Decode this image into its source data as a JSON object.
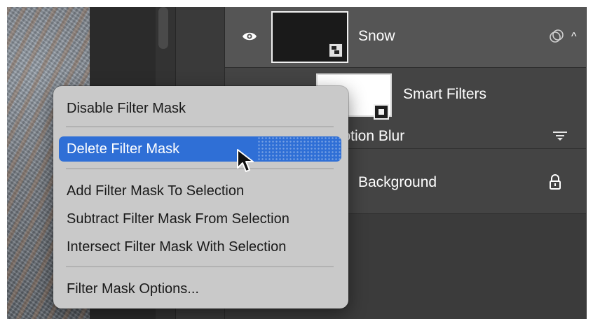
{
  "layers": [
    {
      "name": "Snow",
      "type": "smart-object",
      "visible": true,
      "selected": true
    },
    {
      "name": "Smart Filters",
      "type": "smart-filters"
    },
    {
      "name": "Motion Blur",
      "type": "filter"
    },
    {
      "name": "Background",
      "type": "background",
      "locked": true
    }
  ],
  "context_menu": {
    "items": [
      {
        "label": "Disable Filter Mask"
      },
      {
        "label": "Delete Filter Mask",
        "highlighted": true
      },
      {
        "label": "Add Filter Mask To Selection"
      },
      {
        "label": "Subtract Filter Mask From Selection"
      },
      {
        "label": "Intersect Filter Mask With Selection"
      },
      {
        "label": "Filter Mask Options..."
      }
    ]
  },
  "icons": {
    "visibility": "eye-icon",
    "smart_object": "smart-object-badge-icon",
    "fx": "fx-icon",
    "collapse": "chevron-up-icon",
    "filter_mask": "filter-mask-icon",
    "blend_options": "blend-options-icon",
    "lock": "lock-icon",
    "pointer": "cursor-icon"
  },
  "colors": {
    "menu_highlight": "#2f6fd6",
    "menu_background": "#c9c9c9",
    "selected_layer": "#555555",
    "layer_row": "#444444"
  }
}
